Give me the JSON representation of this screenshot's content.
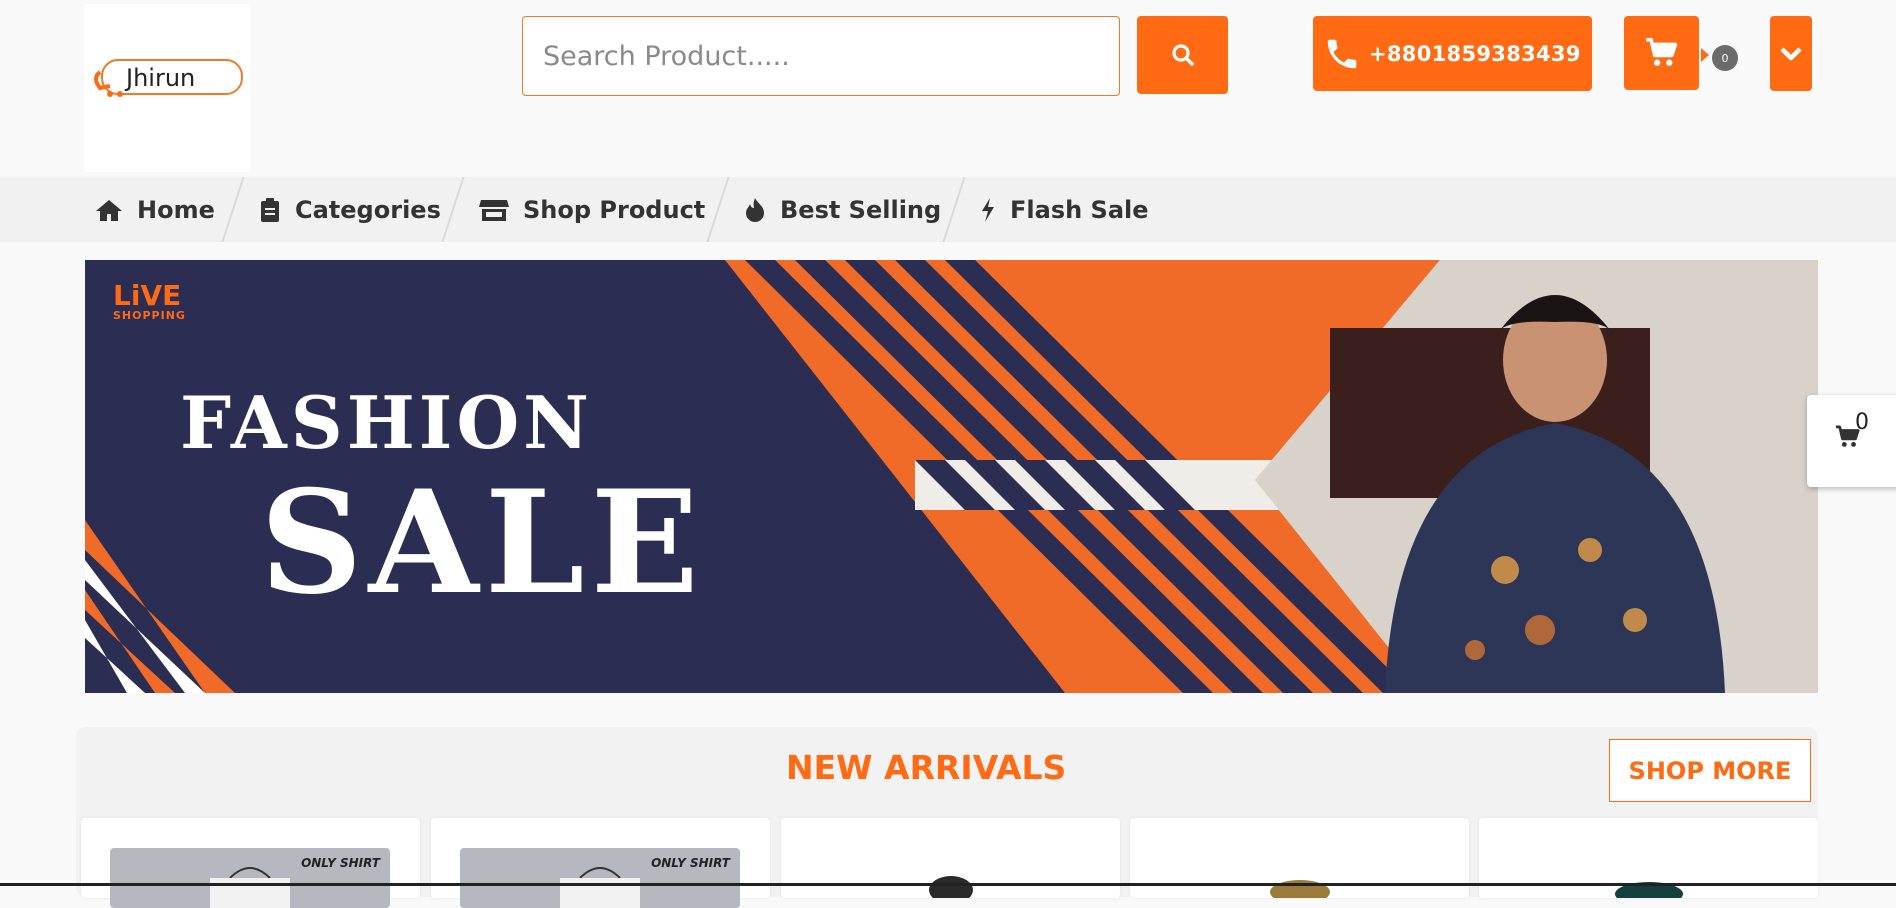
{
  "header": {
    "logo_text": "Jhirun",
    "search_placeholder": "Search Product.....",
    "phone": "+8801859383439",
    "cart_count": "0"
  },
  "nav": {
    "items": [
      {
        "label": "Home",
        "icon": "home-icon"
      },
      {
        "label": "Categories",
        "icon": "clipboard-icon"
      },
      {
        "label": "Shop Product",
        "icon": "store-icon"
      },
      {
        "label": "Best Selling",
        "icon": "fire-icon"
      },
      {
        "label": "Flash Sale",
        "icon": "bolt-icon"
      }
    ]
  },
  "banner": {
    "brand_line1": "LiVE",
    "brand_line2": "SHOPPING",
    "title_line1": "FASHION",
    "title_line2": "SALE"
  },
  "floating_cart": {
    "count": "0"
  },
  "new_arrivals": {
    "title": "NEW ARRIVALS",
    "shop_more": "SHOP MORE",
    "cards": [
      {
        "tag": "ONLY SHIRT"
      },
      {
        "tag": "ONLY SHIRT"
      },
      {
        "tag": ""
      },
      {
        "tag": ""
      },
      {
        "tag": ""
      }
    ]
  },
  "colors": {
    "accent": "#ff6a13",
    "banner_navy": "#2b2d52",
    "nav_bg": "#f1f1f1"
  }
}
